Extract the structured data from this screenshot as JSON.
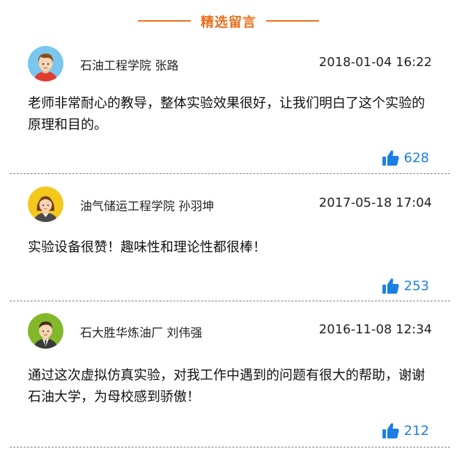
{
  "section": {
    "title": "精选留言"
  },
  "comments": [
    {
      "author": "石油工程学院 张路",
      "time": "2018-01-04 16:22",
      "content": "老师非常耐心的教导，整体实验效果很好，让我们明白了这个实验的原理和目的。",
      "likes": "628",
      "avatar_icon": "male-avatar-icon",
      "avatar_bg": "#7ac6ee"
    },
    {
      "author": "油气储运工程学院 孙羽坤",
      "time": "2017-05-18 17:04",
      "content": "实验设备很赞！趣味性和理论性都很棒！",
      "likes": "253",
      "avatar_icon": "female-avatar-icon",
      "avatar_bg": "#f2c81d"
    },
    {
      "author": "石大胜华炼油厂 刘伟强",
      "time": "2016-11-08 12:34",
      "content": "通过这次虚拟仿真实验，对我工作中遇到的问题有很大的帮助，谢谢石油大学，为母校感到骄傲！",
      "likes": "212",
      "avatar_icon": "male-suit-avatar-icon",
      "avatar_bg": "#82b82a"
    }
  ],
  "colors": {
    "accent": "#ec6d1a",
    "like": "#1a7fe2",
    "divider": "#7a7a7a"
  }
}
